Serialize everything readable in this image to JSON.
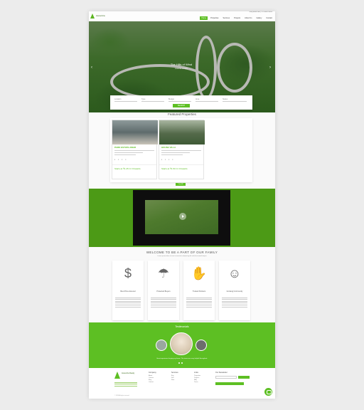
{
  "header": {
    "logo_text": "Ascentria",
    "contact_line": "info@estate.com  |  +91 00000 00000",
    "menu": [
      "Home",
      "Properties",
      "Services",
      "Projects",
      "About Us",
      "Gallery",
      "Contact"
    ]
  },
  "hero": {
    "title": "The Hills of Wind",
    "subtitle": "A scenic escape"
  },
  "search": {
    "fields": [
      "Location",
      "Type",
      "Budget",
      "Area",
      "Status"
    ],
    "button": "SEARCH"
  },
  "featured": {
    "title": "Featured Properties",
    "cards": [
      {
        "title": "PARK ESTATE AWAR",
        "price": "Starts at ₹1.45 Cr Onwards",
        "icons": [
          "bed",
          "bath",
          "car",
          "area"
        ]
      },
      {
        "title": "HOUSE VILLA",
        "price": "Starts at ₹1.50 Cr Onwards",
        "icons": [
          "bed",
          "bath",
          "car",
          "area"
        ]
      }
    ],
    "view_all": "View All"
  },
  "welcome": {
    "title": "WELCOME TO BE A PART OF OUR FAMILY",
    "subtitle": "Lorem ipsum dolor sit amet consectetur adipiscing elit sed do eiusmod tempor",
    "features": [
      {
        "icon": "money-hand-icon",
        "title": "Best Price Assured"
      },
      {
        "icon": "umbrella-family-icon",
        "title": "Protected Buyers"
      },
      {
        "icon": "handshake-icon",
        "title": "Trusted Partners"
      },
      {
        "icon": "people-icon",
        "title": "Growing Community"
      }
    ]
  },
  "testimonials": {
    "title": "Testimonials",
    "quote": "Great experience buying my home. The team was very helpful throughout."
  },
  "footer": {
    "logo_text": "Ascentria Realty",
    "columns": [
      {
        "heading": "Company",
        "items": [
          "About",
          "Careers",
          "Blog",
          "Contact"
        ]
      },
      {
        "heading": "Services",
        "items": [
          "Buy",
          "Sell",
          "Rent"
        ]
      },
      {
        "heading": "Links",
        "items": [
          "Properties",
          "Projects",
          "FAQ",
          "Terms"
        ]
      }
    ],
    "newsletter_heading": "Our Newsletter",
    "copyright": "© 2024 All rights reserved"
  },
  "colors": {
    "accent": "#5dbf23",
    "dark_band": "#4c9a16"
  }
}
